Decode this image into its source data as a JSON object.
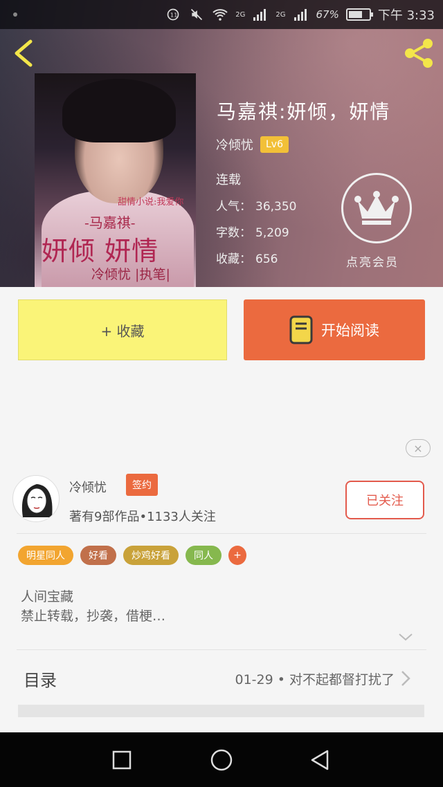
{
  "status_bar": {
    "battery_percent": "67%",
    "battery_level": 0.67,
    "time": "下午 3:33",
    "network_1": "2G",
    "network_2": "2G"
  },
  "book": {
    "title": "马嘉祺:妍倾，妍情",
    "author": "冷倾忧",
    "level": "Lv6",
    "status": "连载",
    "stats": [
      {
        "key": "人气：",
        "value": "36,350"
      },
      {
        "key": "字数：",
        "value": "5,209"
      },
      {
        "key": "收藏：",
        "value": "656"
      }
    ],
    "vip_label": "点亮会员",
    "cover": {
      "small_text": "甜情小说:我爱你",
      "name_text": "-马嘉祺-",
      "big_text": "妍倾 妍情",
      "author_text": "冷倾忧 |执笔|"
    }
  },
  "actions": {
    "collect_label": "+ 收藏",
    "read_label": "开始阅读",
    "close_symbol": "×"
  },
  "author_card": {
    "name": "冷倾忧",
    "badge": "签约",
    "meta": "著有9部作品•1133人关注",
    "follow_label": "已关注"
  },
  "tags": [
    {
      "label": "明星同人",
      "color": "#f2a530"
    },
    {
      "label": "好看",
      "color": "#c1704b"
    },
    {
      "label": "炒鸡好看",
      "color": "#c9a23a"
    },
    {
      "label": "同人",
      "color": "#86b84e"
    },
    {
      "label": "+",
      "color": "#eb6a3f"
    }
  ],
  "description": {
    "line1": "人间宝藏",
    "line2": "禁止转载，抄袭，借梗…"
  },
  "toc": {
    "label": "目录",
    "latest": "01-29 • 对不起都督打扰了"
  },
  "colors": {
    "accent_orange": "#eb6a3f",
    "collect_yellow": "#faf478",
    "level_gold": "#f2c038",
    "follow_red": "#e35a4c"
  }
}
